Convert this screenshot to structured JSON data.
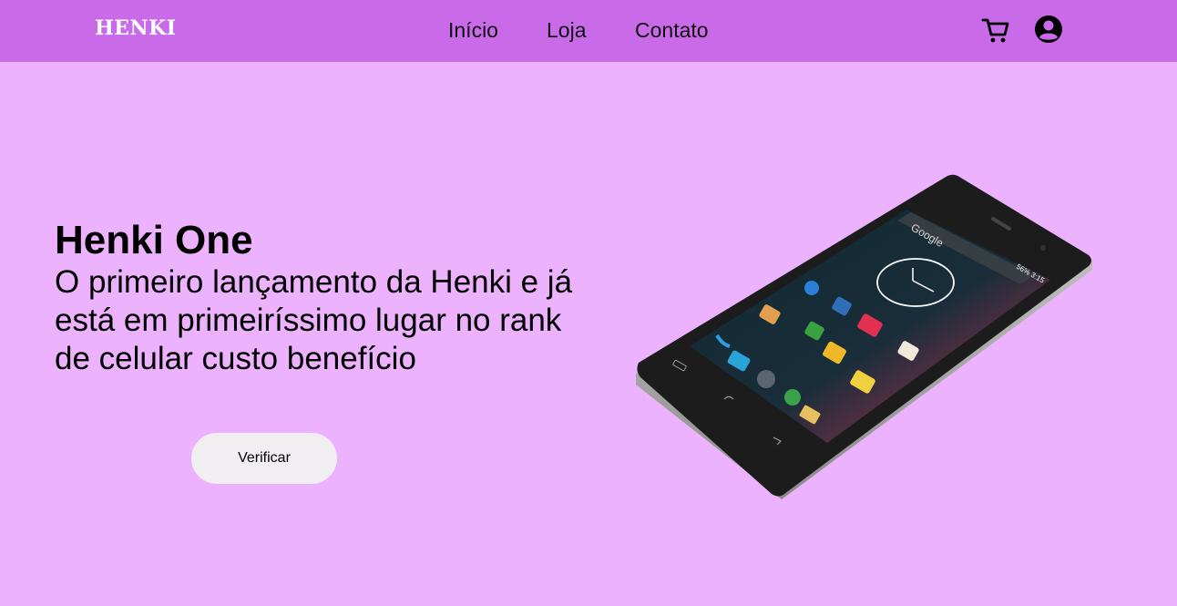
{
  "header": {
    "brand": "HENKI",
    "nav": {
      "inicio": "Início",
      "loja": "Loja",
      "contato": "Contato"
    },
    "icons": {
      "cart": "cart-icon",
      "account": "user-account-icon"
    },
    "colors": {
      "bar": "#c96ae9",
      "page": "#ecb2fd"
    }
  },
  "hero": {
    "title": "Henki One",
    "subtitle": "O primeiro lançamento da Henki e já está em primeiríssimo lugar no rank de celular custo benefício",
    "cta_label": "Verificar",
    "phone": {
      "search_label": "Google",
      "status_text": "56%",
      "clock_text": "3:15"
    }
  }
}
